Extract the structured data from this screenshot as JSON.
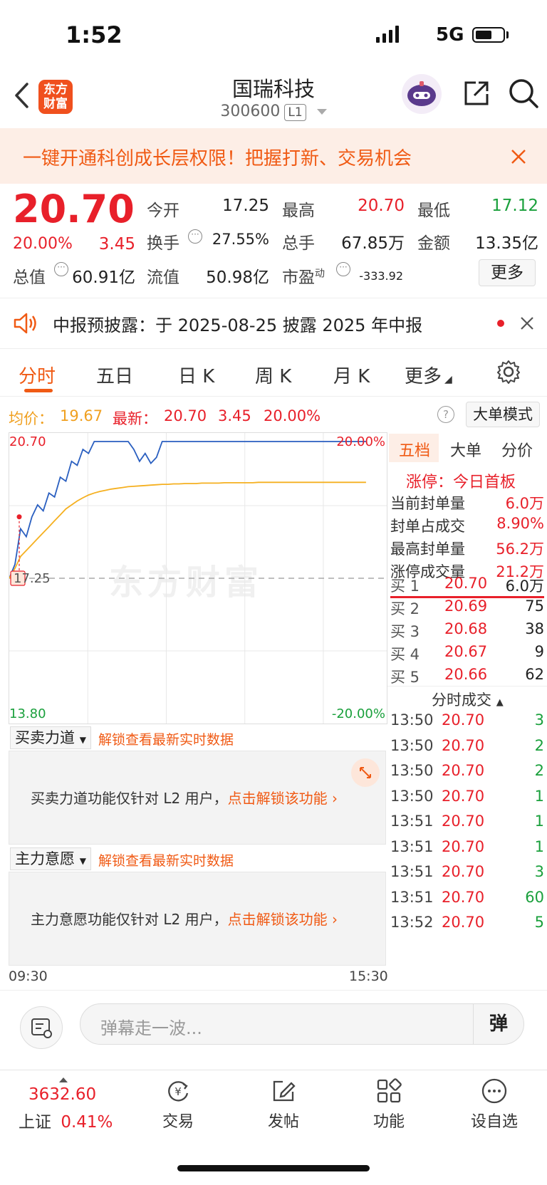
{
  "status_bar": {
    "time": "1:52",
    "network": "5G"
  },
  "header": {
    "logo_line1": "东方",
    "logo_line2": "财富",
    "stock_name": "国瑞科技",
    "stock_code": "300600",
    "level_badge": "L1"
  },
  "banner": {
    "text": "一键开通科创成长层权限！把握打新、交易机会"
  },
  "quote": {
    "price": "20.70",
    "change_pct": "20.00%",
    "change": "3.45",
    "open_label": "今开",
    "open": "17.25",
    "high_label": "最高",
    "high": "20.70",
    "low_label": "最低",
    "low": "17.12",
    "turnover_label": "换手",
    "turnover": "27.55%",
    "volume_label": "总手",
    "volume": "67.85万",
    "amount_label": "金额",
    "amount": "13.35亿",
    "mktcap_label": "总值",
    "mktcap": "60.91亿",
    "float_label": "流值",
    "float_cap": "50.98亿",
    "pe_label": "市盈",
    "pe_sup": "动",
    "pe": "-333.92",
    "more_label": "更多"
  },
  "notice": {
    "text": "中报预披露：于 2025-08-25 披露 2025 年中报"
  },
  "tabs": [
    "分时",
    "五日",
    "日 K",
    "周 K",
    "月 K",
    "更多"
  ],
  "chart_header": {
    "avg_label": "均价：",
    "avg": "19.67",
    "latest_label": "最新：",
    "latest": "20.70",
    "latest_change": "3.45",
    "latest_pct": "20.00%",
    "mode_button": "大单模式"
  },
  "chart_data": {
    "type": "line",
    "y_top": "20.70",
    "y_bottom": "13.80",
    "y_ref": "17.25",
    "pct_top": "20.00%",
    "pct_bottom": "-20.00%",
    "x_start": "09:30",
    "x_end": "15:30",
    "ylim": [
      13.8,
      20.7
    ],
    "ref_price": 17.25,
    "watermark": "东方财富",
    "series": [
      {
        "values": [
          17.25,
          17.6,
          18.5,
          18.3,
          18.8,
          19.1,
          18.95,
          19.4,
          19.3,
          19.8,
          19.7,
          20.2,
          20.1,
          20.5,
          20.4,
          20.7,
          20.7,
          20.7,
          20.7,
          20.7,
          20.7,
          20.7,
          20.5,
          20.2,
          20.4,
          20.15,
          20.3,
          20.7,
          20.7,
          20.7,
          20.7,
          20.7,
          20.7,
          20.7,
          20.7,
          20.7,
          20.7,
          20.7,
          20.7,
          20.7,
          20.7,
          20.7,
          20.7,
          20.7,
          20.7,
          20.7,
          20.7,
          20.7,
          20.7,
          20.7,
          20.7,
          20.7,
          20.7,
          20.7,
          20.7,
          20.7,
          20.7,
          20.7,
          20.7,
          20.7,
          20.7,
          20.7,
          20.7,
          20.7
        ]
      },
      {
        "values": [
          17.25,
          17.5,
          17.8,
          17.95,
          18.1,
          18.25,
          18.4,
          18.55,
          18.7,
          18.85,
          19.0,
          19.1,
          19.2,
          19.28,
          19.35,
          19.4,
          19.44,
          19.47,
          19.5,
          19.52,
          19.54,
          19.56,
          19.57,
          19.58,
          19.59,
          19.6,
          19.61,
          19.62,
          19.62,
          19.63,
          19.63,
          19.64,
          19.64,
          19.64,
          19.65,
          19.65,
          19.65,
          19.65,
          19.66,
          19.66,
          19.66,
          19.66,
          19.66,
          19.66,
          19.67,
          19.67,
          19.67,
          19.67,
          19.67,
          19.67,
          19.67,
          19.67,
          19.67,
          19.67,
          19.67,
          19.67,
          19.67,
          19.67,
          19.67,
          19.67,
          19.67,
          19.67,
          19.67,
          19.67
        ]
      }
    ],
    "total_points": 240
  },
  "right_panel": {
    "tabs": [
      "五档",
      "大单",
      "分价"
    ],
    "limit_up_text": "涨停：今日首板",
    "stats": [
      {
        "label": "当前封单量",
        "value": "6.0万"
      },
      {
        "label": "封单占成交",
        "value": "8.90%"
      },
      {
        "label": "最高封单量",
        "value": "56.2万"
      },
      {
        "label": "涨停成交量",
        "value": "21.2万"
      }
    ],
    "order_book": [
      {
        "label": "买 1",
        "price": "20.70",
        "qty": "6.0万"
      },
      {
        "label": "买 2",
        "price": "20.69",
        "qty": "75"
      },
      {
        "label": "买 3",
        "price": "20.68",
        "qty": "38"
      },
      {
        "label": "买 4",
        "price": "20.67",
        "qty": "9"
      },
      {
        "label": "买 5",
        "price": "20.66",
        "qty": "62"
      }
    ],
    "trades_title": "分时成交",
    "trades": [
      {
        "time": "13:50",
        "price": "20.70",
        "qty": "3"
      },
      {
        "time": "13:50",
        "price": "20.70",
        "qty": "2"
      },
      {
        "time": "13:50",
        "price": "20.70",
        "qty": "2"
      },
      {
        "time": "13:50",
        "price": "20.70",
        "qty": "1"
      },
      {
        "time": "13:51",
        "price": "20.70",
        "qty": "1"
      },
      {
        "time": "13:51",
        "price": "20.70",
        "qty": "1"
      },
      {
        "time": "13:51",
        "price": "20.70",
        "qty": "3"
      },
      {
        "time": "13:51",
        "price": "20.70",
        "qty": "60"
      },
      {
        "time": "13:52",
        "price": "20.70",
        "qty": "5"
      }
    ]
  },
  "panels": {
    "force": {
      "dropdown": "买卖力道",
      "unlock_link": "解锁查看最新实时数据",
      "message": "买卖力道功能仅针对 L2 用户，",
      "message_link": "点击解锁该功能"
    },
    "intent": {
      "dropdown": "主力意愿",
      "unlock_link": "解锁查看最新实时数据",
      "message": "主力意愿功能仅针对 L2 用户，",
      "message_link": "点击解锁该功能"
    },
    "x_start": "09:30",
    "x_end": "15:30"
  },
  "comment_bar": {
    "placeholder": "弹幕走一波...",
    "danmu_button": "弹"
  },
  "bottom_nav": {
    "index_value": "3632.60",
    "index_name": "上证",
    "index_pct": "0.41%",
    "items": [
      "交易",
      "发帖",
      "功能",
      "设自选"
    ]
  }
}
